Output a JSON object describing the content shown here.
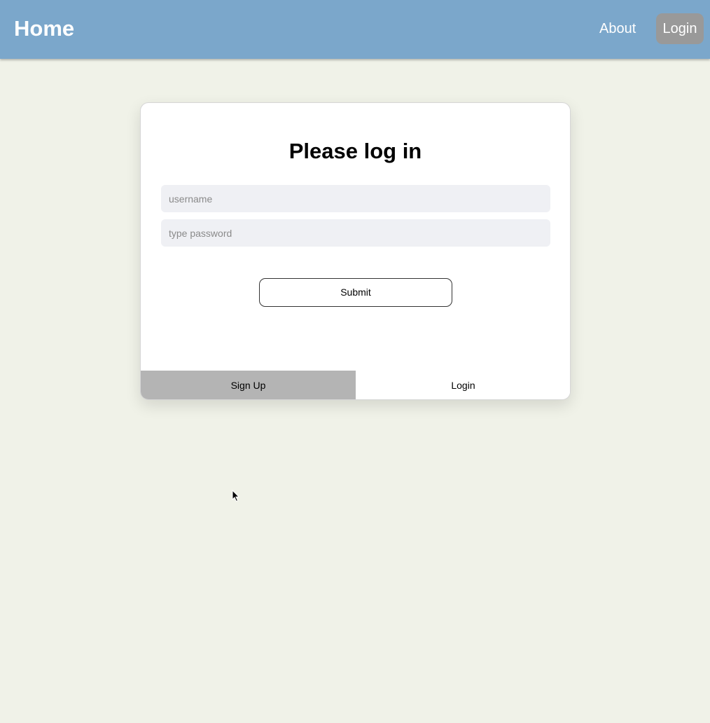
{
  "nav": {
    "home_label": "Home",
    "about_label": "About",
    "login_label": "Login"
  },
  "card": {
    "title": "Please log in",
    "username_placeholder": "username",
    "password_placeholder": "type password",
    "submit_label": "Submit",
    "tabs": [
      {
        "label": "Sign Up"
      },
      {
        "label": "Login"
      }
    ]
  },
  "colors": {
    "navbar": "#7ba7cb",
    "background": "#f0f2e8",
    "nav_login_active": "#999999",
    "tab_inactive": "#b4b4b4"
  },
  "icons": {
    "cursor": "mouse-pointer-icon"
  }
}
